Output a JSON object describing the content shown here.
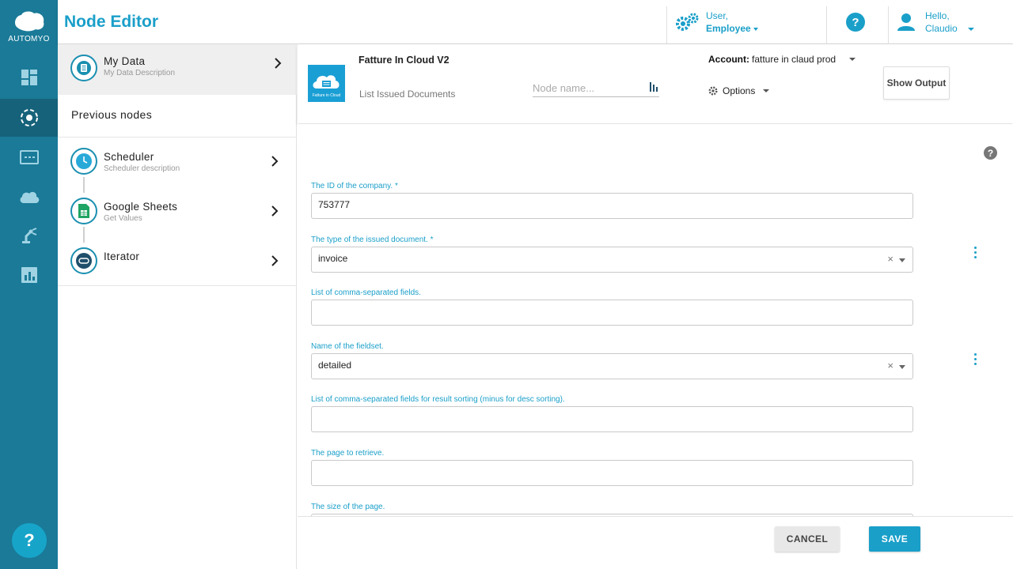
{
  "brand": {
    "logo_text": "AUTOMYO"
  },
  "rail": {
    "items": [
      {
        "icon": "dashboard-icon",
        "active": false
      },
      {
        "icon": "node-editor-icon",
        "active": true
      },
      {
        "icon": "terminal-icon",
        "active": false
      },
      {
        "icon": "cloud-icon",
        "active": false
      },
      {
        "icon": "robot-arm-icon",
        "active": false
      },
      {
        "icon": "bar-chart-icon",
        "active": false
      }
    ],
    "help_label": "?"
  },
  "header": {
    "title": "Node Editor",
    "role_line1": "User,",
    "role_line2": "Employee",
    "help_label": "?",
    "hello_line1": "Hello,",
    "hello_line2": "Claudio"
  },
  "nodes": {
    "my_data": {
      "name": "My Data",
      "description": "My Data Description"
    },
    "previous_label": "Previous nodes",
    "list": [
      {
        "name": "Scheduler",
        "description": "Scheduler description",
        "icon": "clock-icon"
      },
      {
        "name": "Google Sheets",
        "description": "Get Values",
        "icon": "sheets-icon"
      },
      {
        "name": "Iterator",
        "description": "",
        "icon": "iterator-icon"
      }
    ]
  },
  "node_header": {
    "service_title": "Fatture In Cloud V2",
    "service_logo_text": "Fatture in Cloud",
    "action": "List Issued Documents",
    "node_name_placeholder": "Node name...",
    "account_label": "Account:",
    "account_value": "fatture in claud prod",
    "options_label": "Options",
    "show_output_label": "Show Output"
  },
  "form": {
    "help_label": "?",
    "fields": [
      {
        "label": "The ID of the company. *",
        "value": "753777",
        "type": "text"
      },
      {
        "label": "The type of the issued document. *",
        "value": "invoice",
        "type": "select"
      },
      {
        "label": "List of comma-separated fields.",
        "value": "",
        "type": "text"
      },
      {
        "label": "Name of the fieldset.",
        "value": "detailed",
        "type": "select"
      },
      {
        "label": "List of comma-separated fields for result sorting (minus for desc sorting).",
        "value": "",
        "type": "text"
      },
      {
        "label": "The page to retrieve.",
        "value": "",
        "type": "text"
      },
      {
        "label": "The size of the page.",
        "value": "",
        "type": "text"
      }
    ],
    "clear_glyph": "×"
  },
  "footer": {
    "cancel_label": "CANCEL",
    "save_label": "SAVE"
  },
  "colors": {
    "rail": "#1a7a98",
    "accent": "#1a9fc9",
    "active_rail": "#16627a"
  }
}
